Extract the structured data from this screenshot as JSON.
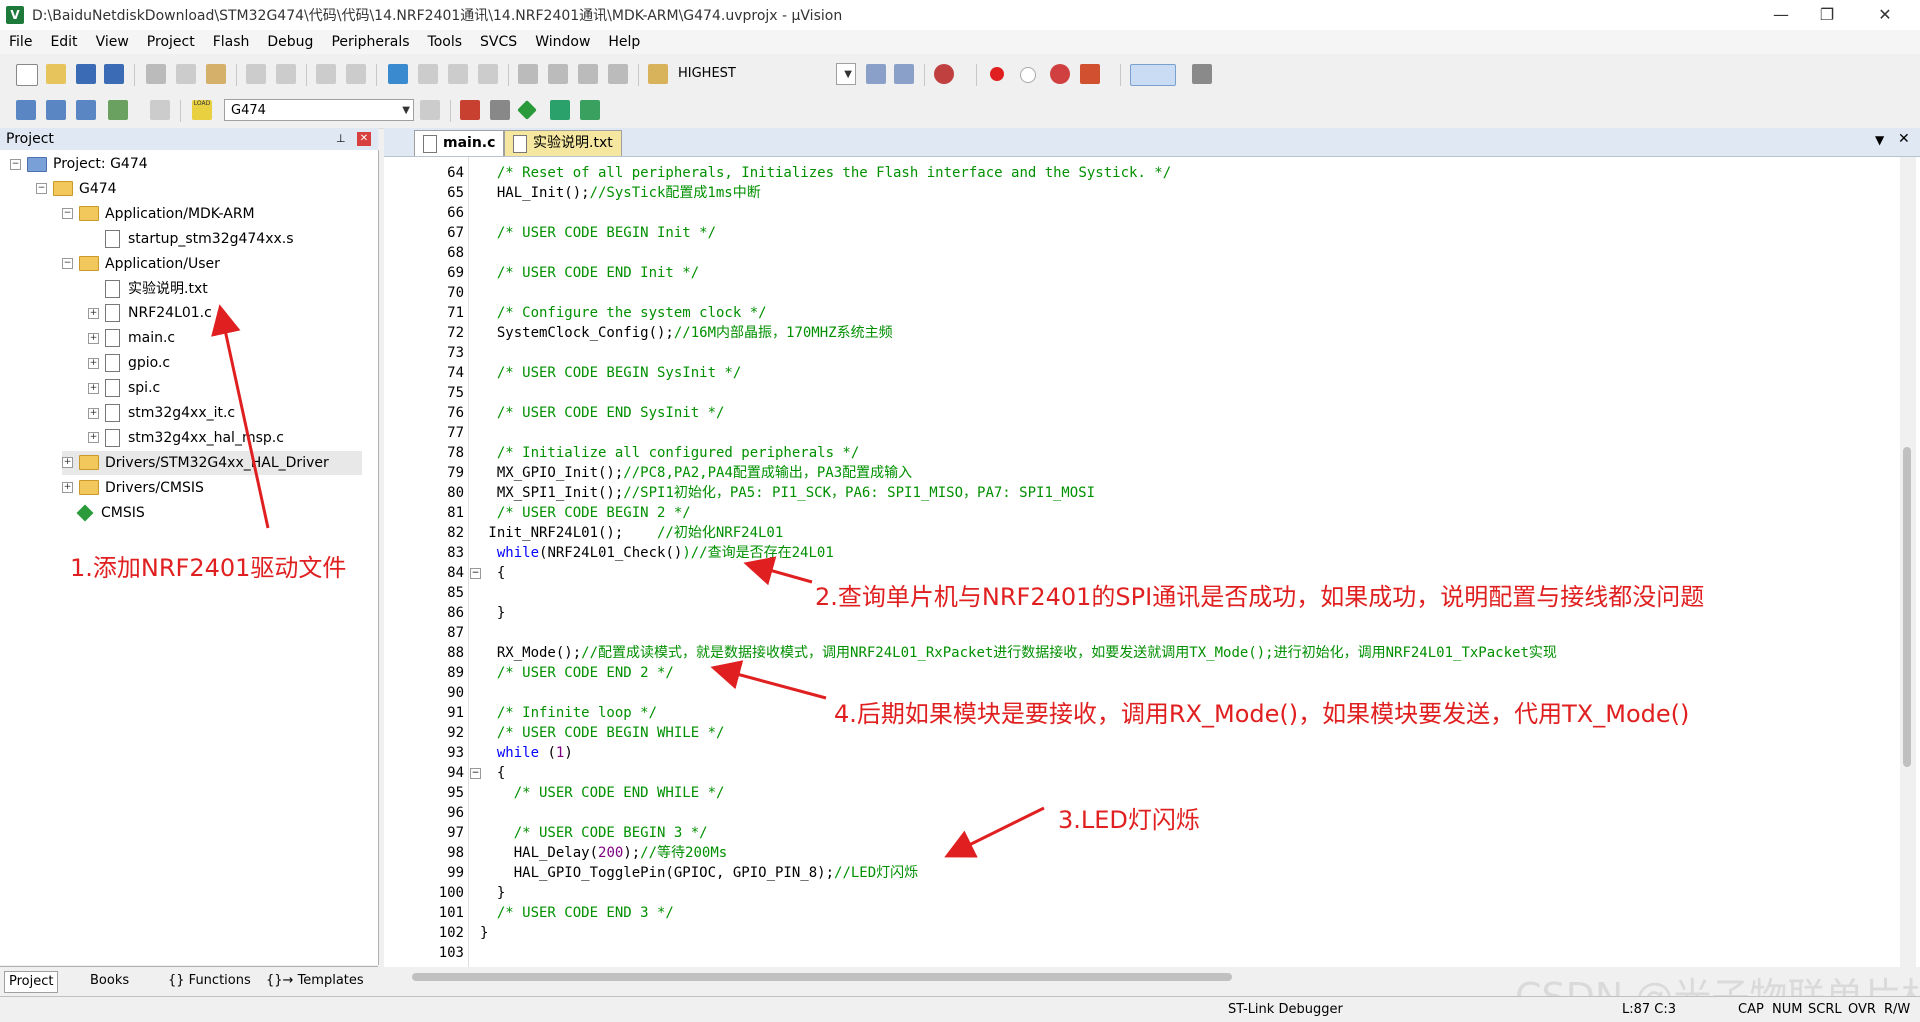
{
  "window": {
    "title": "D:\\BaiduNetdiskDownload\\STM32G474\\代码\\代码\\14.NRF2401通讯\\14.NRF2401通讯\\MDK-ARM\\G474.uvprojx - µVision",
    "app_icon_letter": "V",
    "minimize": "—",
    "maximize": "❐",
    "close": "✕"
  },
  "menu": [
    "File",
    "Edit",
    "View",
    "Project",
    "Flash",
    "Debug",
    "Peripherals",
    "Tools",
    "SVCS",
    "Window",
    "Help"
  ],
  "toolbar1": {
    "find_combo": "HIGHEST"
  },
  "toolbar2": {
    "target_combo": "G474",
    "load_label": "LOAD"
  },
  "project_pane": {
    "title": "Project",
    "pin": "📌",
    "close": "✕",
    "tree": [
      {
        "label": "Project: G474",
        "level": 0,
        "kind": "project",
        "expander": "−"
      },
      {
        "label": "G474",
        "level": 1,
        "kind": "target",
        "expander": "−"
      },
      {
        "label": "Application/MDK-ARM",
        "level": 2,
        "kind": "folder",
        "expander": "−"
      },
      {
        "label": "startup_stm32g474xx.s",
        "level": 3,
        "kind": "file",
        "expander": ""
      },
      {
        "label": "Application/User",
        "level": 2,
        "kind": "folder",
        "expander": "−"
      },
      {
        "label": "实验说明.txt",
        "level": 3,
        "kind": "file",
        "expander": ""
      },
      {
        "label": "NRF24L01.c",
        "level": 3,
        "kind": "file",
        "expander": "+"
      },
      {
        "label": "main.c",
        "level": 3,
        "kind": "file",
        "expander": "+"
      },
      {
        "label": "gpio.c",
        "level": 3,
        "kind": "file",
        "expander": "+"
      },
      {
        "label": "spi.c",
        "level": 3,
        "kind": "file",
        "expander": "+"
      },
      {
        "label": "stm32g4xx_it.c",
        "level": 3,
        "kind": "file",
        "expander": "+"
      },
      {
        "label": "stm32g4xx_hal_msp.c",
        "level": 3,
        "kind": "file",
        "expander": "+"
      },
      {
        "label": "Drivers/STM32G4xx_HAL_Driver",
        "level": 2,
        "kind": "folder",
        "expander": "+"
      },
      {
        "label": "Drivers/CMSIS",
        "level": 2,
        "kind": "folder",
        "expander": "+"
      },
      {
        "label": "CMSIS",
        "level": 2,
        "kind": "cmsis",
        "expander": ""
      }
    ],
    "bottom_tabs": [
      "Project",
      "Books",
      "{} Functions",
      "{}→ Templates"
    ]
  },
  "editor": {
    "tabs": [
      {
        "label": "main.c",
        "active": true
      },
      {
        "label": "实验说明.txt",
        "active": false
      }
    ],
    "lines": [
      {
        "n": "64",
        "t": "  /* Reset of all peripherals, Initializes the Flash interface and the Systick. */",
        "c": "cmt",
        "fold": ""
      },
      {
        "n": "65",
        "t": "  HAL_Init();//SysTick配置成1ms中断",
        "c": "mix",
        "split": 13,
        "fold": ""
      },
      {
        "n": "66",
        "t": "",
        "c": "",
        "fold": ""
      },
      {
        "n": "67",
        "t": "  /* USER CODE BEGIN Init */",
        "c": "cmt",
        "fold": ""
      },
      {
        "n": "68",
        "t": "",
        "c": "",
        "fold": ""
      },
      {
        "n": "69",
        "t": "  /* USER CODE END Init */",
        "c": "cmt",
        "fold": ""
      },
      {
        "n": "70",
        "t": "",
        "c": "",
        "fold": ""
      },
      {
        "n": "71",
        "t": "  /* Configure the system clock */",
        "c": "cmt",
        "fold": ""
      },
      {
        "n": "72",
        "t": "  SystemClock_Config();//16M内部晶振，170MHZ系统主频",
        "c": "mix",
        "split": 23,
        "fold": ""
      },
      {
        "n": "73",
        "t": "",
        "c": "",
        "fold": ""
      },
      {
        "n": "74",
        "t": "  /* USER CODE BEGIN SysInit */",
        "c": "cmt",
        "fold": ""
      },
      {
        "n": "75",
        "t": "",
        "c": "",
        "fold": ""
      },
      {
        "n": "76",
        "t": "  /* USER CODE END SysInit */",
        "c": "cmt",
        "fold": ""
      },
      {
        "n": "77",
        "t": "",
        "c": "",
        "fold": ""
      },
      {
        "n": "78",
        "t": "  /* Initialize all configured peripherals */",
        "c": "cmt",
        "fold": ""
      },
      {
        "n": "79",
        "t": "  MX_GPIO_Init();//PC8,PA2,PA4配置成输出，PA3配置成输入",
        "c": "mix",
        "split": 17,
        "fold": ""
      },
      {
        "n": "80",
        "t": "  MX_SPI1_Init();//SPI1初始化，PA5: PI1_SCK，PA6: SPI1_MISO，PA7: SPI1_MOSI",
        "c": "mix",
        "split": 17,
        "fold": ""
      },
      {
        "n": "81",
        "t": "  /* USER CODE BEGIN 2 */",
        "c": "cmt",
        "fold": ""
      },
      {
        "n": "82",
        "t": " Init_NRF24L01();    //初始化NRF24L01",
        "c": "mix",
        "split": 20,
        "fold": ""
      },
      {
        "n": "83",
        "t": "  while(NRF24L01_Check())//查询是否存在24L01",
        "c": "while",
        "split": 24,
        "fold": ""
      },
      {
        "n": "84",
        "t": "  {",
        "c": "",
        "fold": "−"
      },
      {
        "n": "85",
        "t": "",
        "c": "",
        "fold": ""
      },
      {
        "n": "86",
        "t": "  }",
        "c": "",
        "fold": ""
      },
      {
        "n": "87",
        "t": "",
        "c": "",
        "fold": ""
      },
      {
        "n": "88",
        "t": "  RX_Mode();//配置成读模式，就是数据接收模式，调用NRF24L01_RxPacket进行数据接收，如要发送就调用TX_Mode();进行初始化，调用NRF24L01_TxPacket实现",
        "c": "mix",
        "split": 12,
        "fold": ""
      },
      {
        "n": "89",
        "t": "  /* USER CODE END 2 */",
        "c": "cmt",
        "fold": ""
      },
      {
        "n": "90",
        "t": "",
        "c": "",
        "fold": ""
      },
      {
        "n": "91",
        "t": "  /* Infinite loop */",
        "c": "cmt",
        "fold": ""
      },
      {
        "n": "92",
        "t": "  /* USER CODE BEGIN WHILE */",
        "c": "cmt",
        "fold": ""
      },
      {
        "n": "93",
        "t": "  while (1)",
        "c": "while1",
        "fold": ""
      },
      {
        "n": "94",
        "t": "  {",
        "c": "",
        "fold": "−"
      },
      {
        "n": "95",
        "t": "    /* USER CODE END WHILE */",
        "c": "cmt",
        "fold": ""
      },
      {
        "n": "96",
        "t": "",
        "c": "",
        "fold": ""
      },
      {
        "n": "97",
        "t": "    /* USER CODE BEGIN 3 */",
        "c": "cmt",
        "fold": ""
      },
      {
        "n": "98",
        "t": "    HAL_Delay(200);//等待200Ms",
        "c": "delay",
        "fold": ""
      },
      {
        "n": "99",
        "t": "    HAL_GPIO_TogglePin(GPIOC, GPIO_PIN_8);//LED灯闪烁",
        "c": "mix",
        "split": 42,
        "fold": ""
      },
      {
        "n": "100",
        "t": "  }",
        "c": "",
        "fold": ""
      },
      {
        "n": "101",
        "t": "  /* USER CODE END 3 */",
        "c": "cmt",
        "fold": ""
      },
      {
        "n": "102",
        "t": "}",
        "c": "",
        "fold": ""
      },
      {
        "n": "103",
        "t": "",
        "c": "",
        "fold": ""
      }
    ]
  },
  "annotations": [
    "1.添加NRF2401驱动文件",
    "2.查询单片机与NRF2401的SPI通讯是否成功，如果成功，说明配置与接线都没问题",
    "4.后期如果模块是要接收，调用RX_Mode()，如果模块要发送，代用TX_Mode()",
    "3.LED灯闪烁"
  ],
  "status": {
    "debugger": "ST-Link Debugger",
    "position": "L:87 C:3",
    "cap": "CAP",
    "num": "NUM",
    "scrl": "SCRL",
    "ovr": "OVR",
    "rw": "R/W"
  },
  "watermark": "CSDN @光子物联单片机",
  "colors": {
    "comment": "#009000",
    "keyword": "#0000ff",
    "number": "#800080",
    "annotation": "#e02020",
    "pane_header": "#dfe8f3",
    "active_tab": "#ffffff",
    "inactive_tab": "#f5e7a0"
  }
}
